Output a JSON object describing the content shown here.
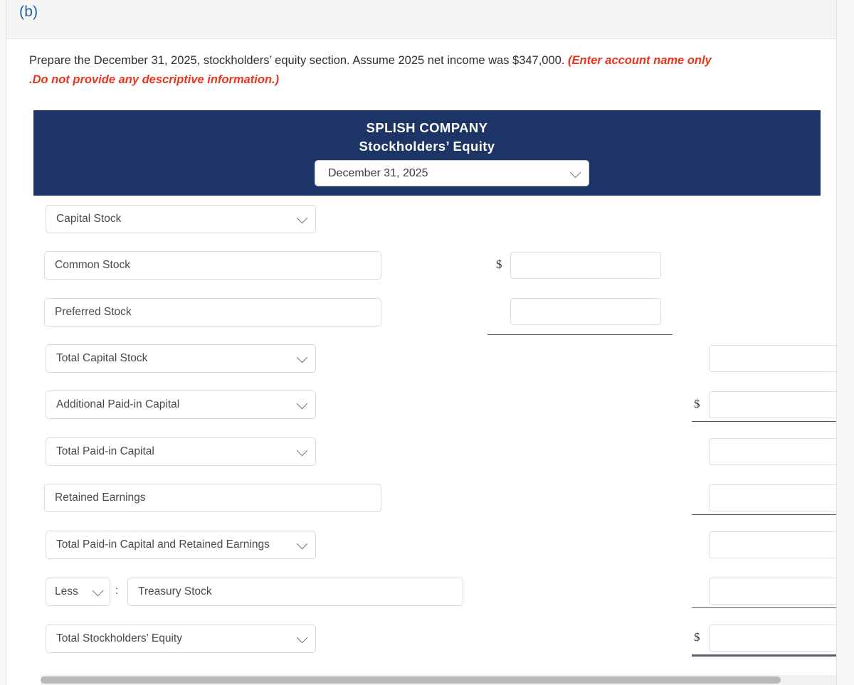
{
  "part": {
    "label": "(b)"
  },
  "instructions": {
    "main": "Prepare the December 31, 2025, stockholders’ equity section. Assume 2025 net income was $347,000. ",
    "hint_line1": "(Enter account name only",
    "hint_line2": ".Do not provide any descriptive information.)"
  },
  "statement": {
    "company": "SPLISH COMPANY",
    "title": "Stockholders’ Equity",
    "date_select": {
      "value": "December 31, 2025",
      "icon": "chevron-down-icon"
    }
  },
  "colors": {
    "header_navy": "#1c3466",
    "hint_red": "#e8351c",
    "part_label_blue": "#2a5f9e"
  },
  "symbols": {
    "dollar": "$",
    "colon": ":"
  },
  "rows": [
    {
      "id": "capital-stock",
      "label": "Capital Stock",
      "control": "select",
      "value": ""
    },
    {
      "id": "common-stock",
      "label": "Common Stock",
      "control": "input",
      "value": ""
    },
    {
      "id": "preferred-stock",
      "label": "Preferred Stock",
      "control": "input",
      "value": ""
    },
    {
      "id": "total-capital-stock",
      "label": "Total Capital Stock",
      "control": "select",
      "value": ""
    },
    {
      "id": "additional-paid-in-capital",
      "label": "Additional Paid-in Capital",
      "control": "select",
      "value": ""
    },
    {
      "id": "total-paid-in-capital",
      "label": "Total Paid-in Capital",
      "control": "select",
      "value": ""
    },
    {
      "id": "retained-earnings",
      "label": "Retained Earnings",
      "control": "input",
      "value": ""
    },
    {
      "id": "total-paid-in-capital-and-retained-earnings",
      "label": "Total Paid-in Capital and Retained Earnings",
      "control": "select",
      "value": ""
    },
    {
      "id": "less-treasury-stock",
      "label": "Treasury Stock",
      "prefix_select": "Less",
      "control": "input",
      "value": ""
    },
    {
      "id": "total-stockholders-equity",
      "label": "Total Stockholders' Equity",
      "control": "select",
      "value": ""
    }
  ],
  "amounts": {
    "common_stock": "",
    "preferred_stock": "",
    "total_capital_stock": "",
    "additional_paid_in_capital": "",
    "total_paid_in_capital": "",
    "retained_earnings": "",
    "total_paid_in_capital_and_retained_earnings": "",
    "treasury_stock": "",
    "total_stockholders_equity": ""
  },
  "scrollbar": {
    "orientation": "horizontal"
  }
}
